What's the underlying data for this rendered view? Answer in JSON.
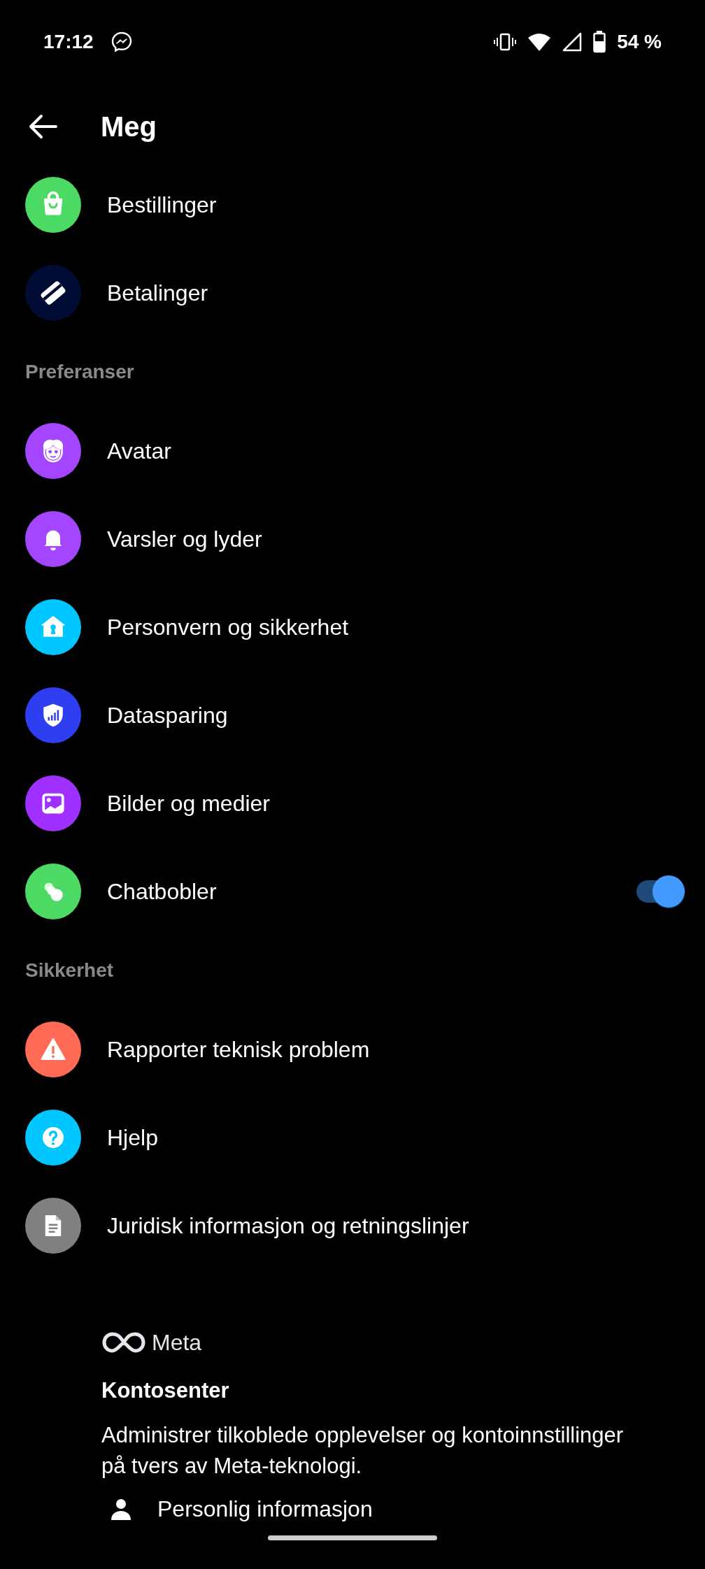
{
  "status_bar": {
    "time": "17:12",
    "battery": "54 %"
  },
  "header": {
    "title": "Meg"
  },
  "sections": [
    {
      "items": [
        {
          "kind": "link",
          "label": "Bestillinger",
          "color": "#4cd964"
        },
        {
          "kind": "link",
          "label": "Betalinger",
          "color": "#000c33"
        }
      ]
    },
    {
      "heading": "Preferanser",
      "items": [
        {
          "kind": "link",
          "label": "Avatar",
          "color": "#a445ff"
        },
        {
          "kind": "link",
          "label": "Varsler og lyder",
          "color": "#a445ff"
        },
        {
          "kind": "link",
          "label": "Personvern og sikkerhet",
          "color": "#00c6ff"
        },
        {
          "kind": "link",
          "label": "Datasparing",
          "color": "#2d3ff0"
        },
        {
          "kind": "link",
          "label": "Bilder og medier",
          "color": "#a030ff"
        },
        {
          "kind": "toggle",
          "label": "Chatbobler",
          "color": "#4cd964",
          "on": true
        }
      ]
    },
    {
      "heading": "Sikkerhet",
      "items": [
        {
          "kind": "link",
          "label": "Rapporter teknisk problem",
          "color": "#ff6b55"
        },
        {
          "kind": "link",
          "label": "Hjelp",
          "color": "#00c6ff"
        },
        {
          "kind": "link",
          "label": "Juridisk informasjon og retningslinjer",
          "color": "#808080"
        }
      ]
    }
  ],
  "account_center": {
    "brand": "Meta",
    "title": "Kontosenter",
    "description": "Administrer tilkoblede opplevelser og kontoinnstillinger på tvers av Meta-teknologi.",
    "items": [
      {
        "label": "Personlig informasjon"
      }
    ]
  }
}
